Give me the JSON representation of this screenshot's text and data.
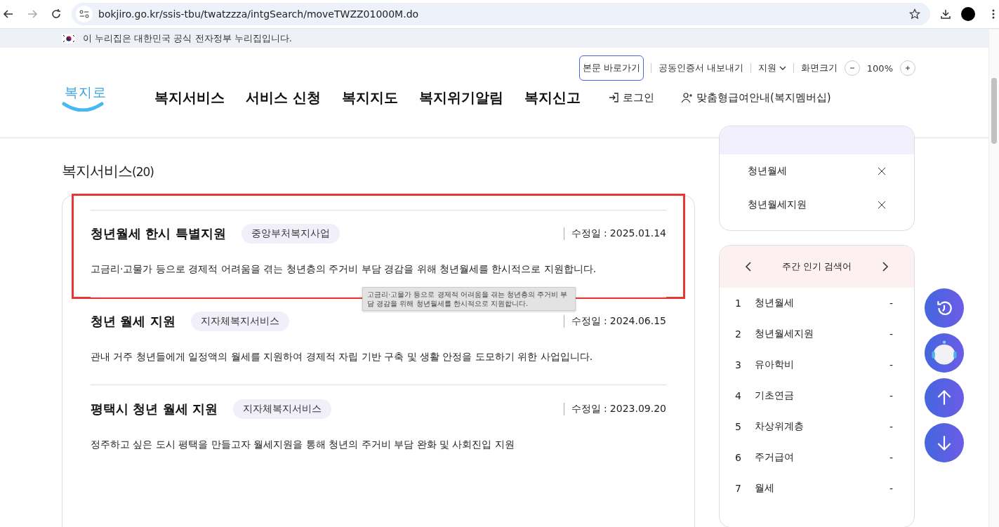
{
  "browser": {
    "url": "bokjiro.go.kr/ssis-tbu/twatzzza/intgSearch/moveTWZZ01000M.do"
  },
  "gov_banner": {
    "text": "이 누리집은 대한민국 공식 전자정부 누리집입니다."
  },
  "utility": {
    "links": [
      {
        "label": "본문 바로가기",
        "kind": "outlined"
      },
      {
        "label": "공동인증서 내보내기",
        "kind": "plain"
      },
      {
        "label": "지원",
        "kind": "dropdown"
      }
    ],
    "zoom_label": "화면크기",
    "zoom_value": "100%"
  },
  "header": {
    "logo_text": "복지로",
    "menu": [
      "복지서비스",
      "서비스 신청",
      "복지지도",
      "복지위기알림",
      "복지신고"
    ],
    "login": "로그인",
    "membership": "맞춤형급여안내(복지멤버십)"
  },
  "results": {
    "title": "복지서비스",
    "count": "(20)",
    "items": [
      {
        "title": "청년월세 한시 특별지원",
        "tag": "중앙부처복지사업",
        "date_label": "수정일 :",
        "date": "2025.01.14",
        "description": "고금리·고물가 등으로 경제적 어려움을 겪는 청년층의 주거비 부담 경감을 위해 청년월세를 한시적으로 지원합니다.",
        "highlighted": true
      },
      {
        "title": "청년 월세 지원",
        "tag": "지자체복지서비스",
        "date_label": "수정일 :",
        "date": "2024.06.15",
        "description": "관내 거주 청년들에게 일정액의 월세를 지원하여 경제적 자립 기반 구축 및 생활 안정을 도모하기 위한 사업입니다.",
        "highlighted": false
      },
      {
        "title": "평택시 청년 월세 지원",
        "tag": "지자체복지서비스",
        "date_label": "수정일 :",
        "date": "2023.09.20",
        "description": "정주하고 싶은 도시 평택을 만들고자 월세지원을 통해 청년의 주거비 부담 완화 및 사회진입 지원",
        "highlighted": false
      }
    ]
  },
  "tooltip": {
    "text": "고금리·고물가 등으로 경제적 어려움을 겪는 청년층의 주거비 부담 경감을 위해 청년월세를 한시적으로 지원합니다."
  },
  "recent_searches": {
    "items": [
      {
        "label": "청년월세"
      },
      {
        "label": "청년월세지원"
      }
    ]
  },
  "popular": {
    "title": "주간 인기 검색어",
    "items": [
      {
        "rank": "1",
        "label": "청년월세",
        "change": "-"
      },
      {
        "rank": "2",
        "label": "청년월세지원",
        "change": "-"
      },
      {
        "rank": "3",
        "label": "유아학비",
        "change": "-"
      },
      {
        "rank": "4",
        "label": "기초연금",
        "change": "-"
      },
      {
        "rank": "5",
        "label": "차상위계층",
        "change": "-"
      },
      {
        "rank": "6",
        "label": "주거급여",
        "change": "-"
      },
      {
        "rank": "7",
        "label": "월세",
        "change": "-"
      }
    ]
  },
  "float_buttons": [
    {
      "kind": "history"
    },
    {
      "kind": "chatbot"
    },
    {
      "kind": "up"
    },
    {
      "kind": "down"
    }
  ]
}
